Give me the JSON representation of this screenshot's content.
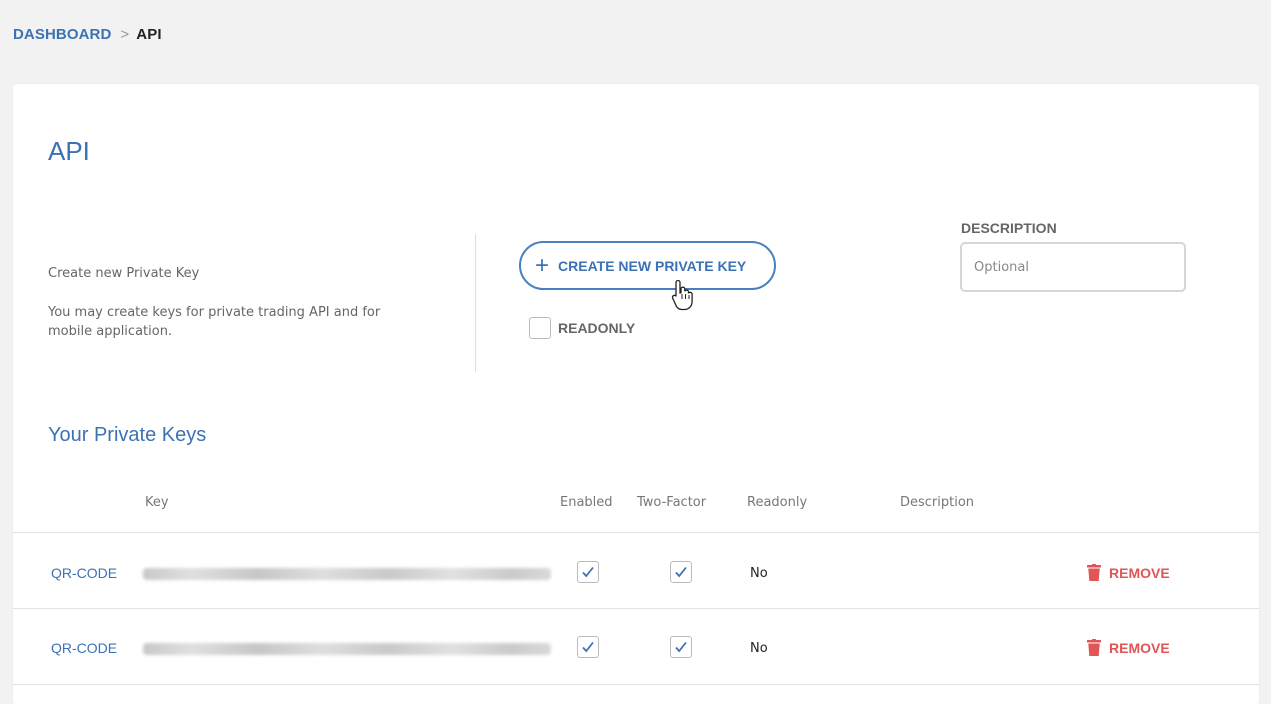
{
  "breadcrumb": {
    "root": "DASHBOARD",
    "separator": ">",
    "current": "API"
  },
  "page": {
    "title": "API"
  },
  "create_section": {
    "title": "Create new Private Key",
    "description": "You may create keys for private trading API and for mobile application.",
    "button_label": "CREATE NEW PRIVATE KEY",
    "button_icon": "plus-icon",
    "readonly_label": "READONLY",
    "readonly_checked": false
  },
  "description_field": {
    "label": "DESCRIPTION",
    "placeholder": "Optional",
    "value": ""
  },
  "keys_section": {
    "title": "Your Private Keys",
    "columns": [
      "Key",
      "Enabled",
      "Two-Factor",
      "Readonly",
      "Description"
    ],
    "rows": [
      {
        "qr_label": "QR-CODE",
        "enabled": true,
        "two_factor": true,
        "readonly": "No",
        "description": "",
        "remove_label": "REMOVE"
      },
      {
        "qr_label": "QR-CODE",
        "enabled": true,
        "two_factor": true,
        "readonly": "No",
        "description": "",
        "remove_label": "REMOVE"
      }
    ]
  },
  "colors": {
    "accent": "#3c72b4",
    "danger": "#e05555",
    "background": "#f2f2f2",
    "card": "#ffffff"
  }
}
